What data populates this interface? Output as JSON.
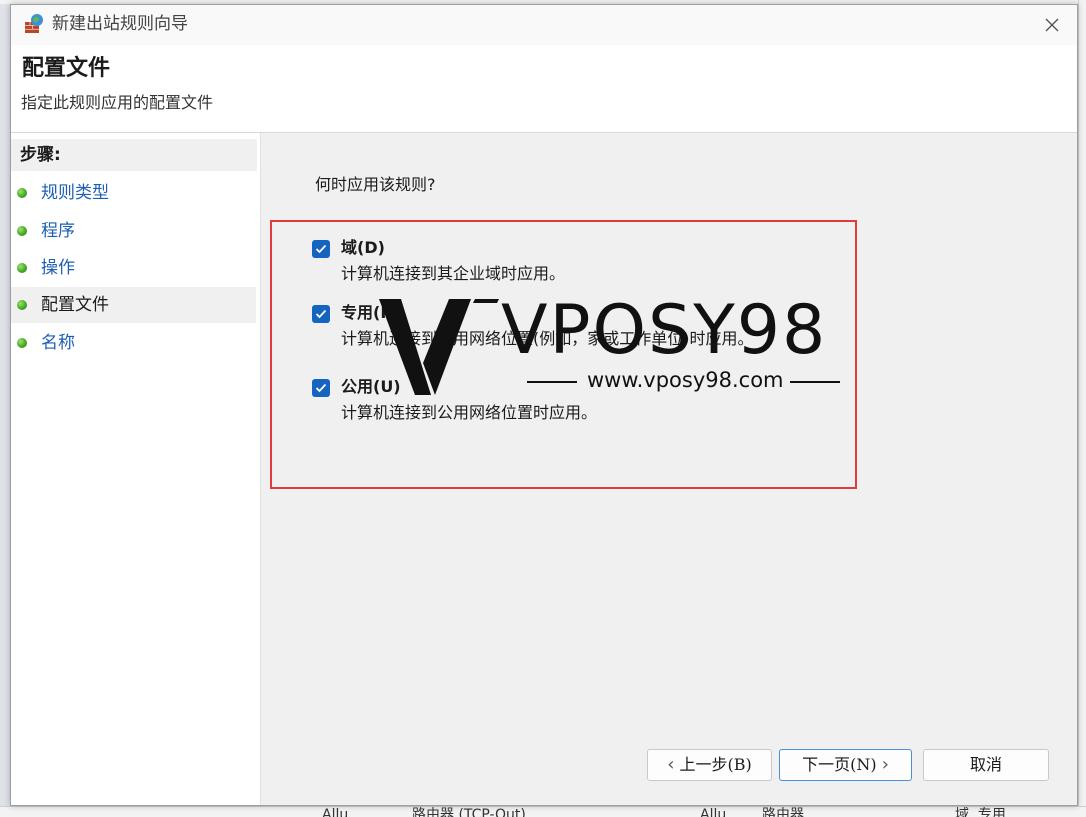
{
  "window": {
    "title": "新建出站规则向导",
    "close_icon": "close-icon"
  },
  "header": {
    "title": "配置文件",
    "subtitle": "指定此规则应用的配置文件"
  },
  "sidebar": {
    "header": "步骤:",
    "items": [
      {
        "label": "规则类型",
        "current": false
      },
      {
        "label": "程序",
        "current": false
      },
      {
        "label": "操作",
        "current": false
      },
      {
        "label": "配置文件",
        "current": true
      },
      {
        "label": "名称",
        "current": false
      }
    ]
  },
  "main": {
    "question": "何时应用该规则?",
    "options": [
      {
        "label": "域(D)",
        "description": "计算机连接到其企业域时应用。",
        "checked": true
      },
      {
        "label": "专用(P)",
        "description": "计算机连接到专用网络位置(例如，家或工作单位)时应用。",
        "checked": true
      },
      {
        "label": "公用(U)",
        "description": "计算机连接到公用网络位置时应用。",
        "checked": true
      }
    ]
  },
  "watermark": {
    "brand": "VPOSY98",
    "url": "www.vposy98.com"
  },
  "buttons": {
    "back": "上一步(B)",
    "next": "下一页(N)",
    "cancel": "取消"
  },
  "background": {
    "row_text": [
      "Allu...",
      "路由器 (TCP-Out)",
      "Allu...",
      "路由器",
      "域, 专用"
    ]
  },
  "colors": {
    "accent": "#1565c0",
    "highlight": "#e03c3c",
    "link": "#1d5fb5"
  }
}
